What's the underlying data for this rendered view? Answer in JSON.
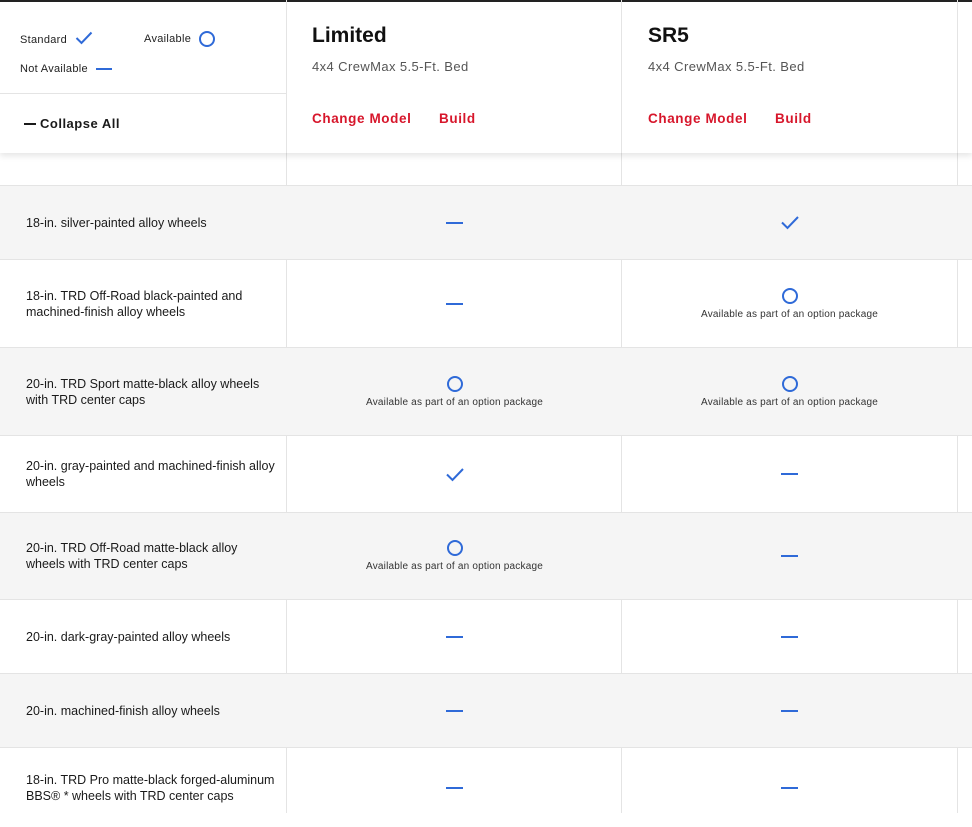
{
  "legend": {
    "standard_label": "Standard",
    "available_label": "Available",
    "not_available_label": "Not Available"
  },
  "collapse_label": "Collapse All",
  "models": [
    {
      "name": "Limited",
      "config": "4x4 CrewMax 5.5-Ft. Bed",
      "change_label": "Change Model",
      "build_label": "Build"
    },
    {
      "name": "SR5",
      "config": "4x4 CrewMax 5.5-Ft. Bed",
      "change_label": "Change Model",
      "build_label": "Build"
    }
  ],
  "colors": {
    "accent": "#d7162b",
    "icon": "#2f6ad8",
    "row_shade": "#f5f5f5"
  },
  "rows": [
    {
      "label": "18-in. silver-painted alloy wheels",
      "values": [
        {
          "status": "not_available"
        },
        {
          "status": "standard"
        }
      ]
    },
    {
      "label": "18-in. TRD Off-Road black-painted and machined-finish alloy wheels",
      "values": [
        {
          "status": "not_available"
        },
        {
          "status": "available",
          "note": "Available as part of an option package"
        }
      ]
    },
    {
      "label": "20-in. TRD Sport matte-black alloy wheels with TRD center caps",
      "values": [
        {
          "status": "available",
          "note": "Available as part of an option package"
        },
        {
          "status": "available",
          "note": "Available as part of an option package"
        }
      ]
    },
    {
      "label": "20-in. gray-painted and machined-finish alloy wheels",
      "values": [
        {
          "status": "standard"
        },
        {
          "status": "not_available"
        }
      ]
    },
    {
      "label": "20-in. TRD Off-Road matte-black alloy wheels with TRD center caps",
      "values": [
        {
          "status": "available",
          "note": "Available as part of an option package"
        },
        {
          "status": "not_available"
        }
      ]
    },
    {
      "label": "20-in. dark-gray-painted alloy wheels",
      "values": [
        {
          "status": "not_available"
        },
        {
          "status": "not_available"
        }
      ]
    },
    {
      "label": "20-in. machined-finish alloy wheels",
      "values": [
        {
          "status": "not_available"
        },
        {
          "status": "not_available"
        }
      ]
    },
    {
      "label": "18-in. TRD Pro matte-black forged-aluminum BBS® * wheels with TRD center caps",
      "values": [
        {
          "status": "not_available"
        },
        {
          "status": "not_available"
        }
      ]
    }
  ]
}
